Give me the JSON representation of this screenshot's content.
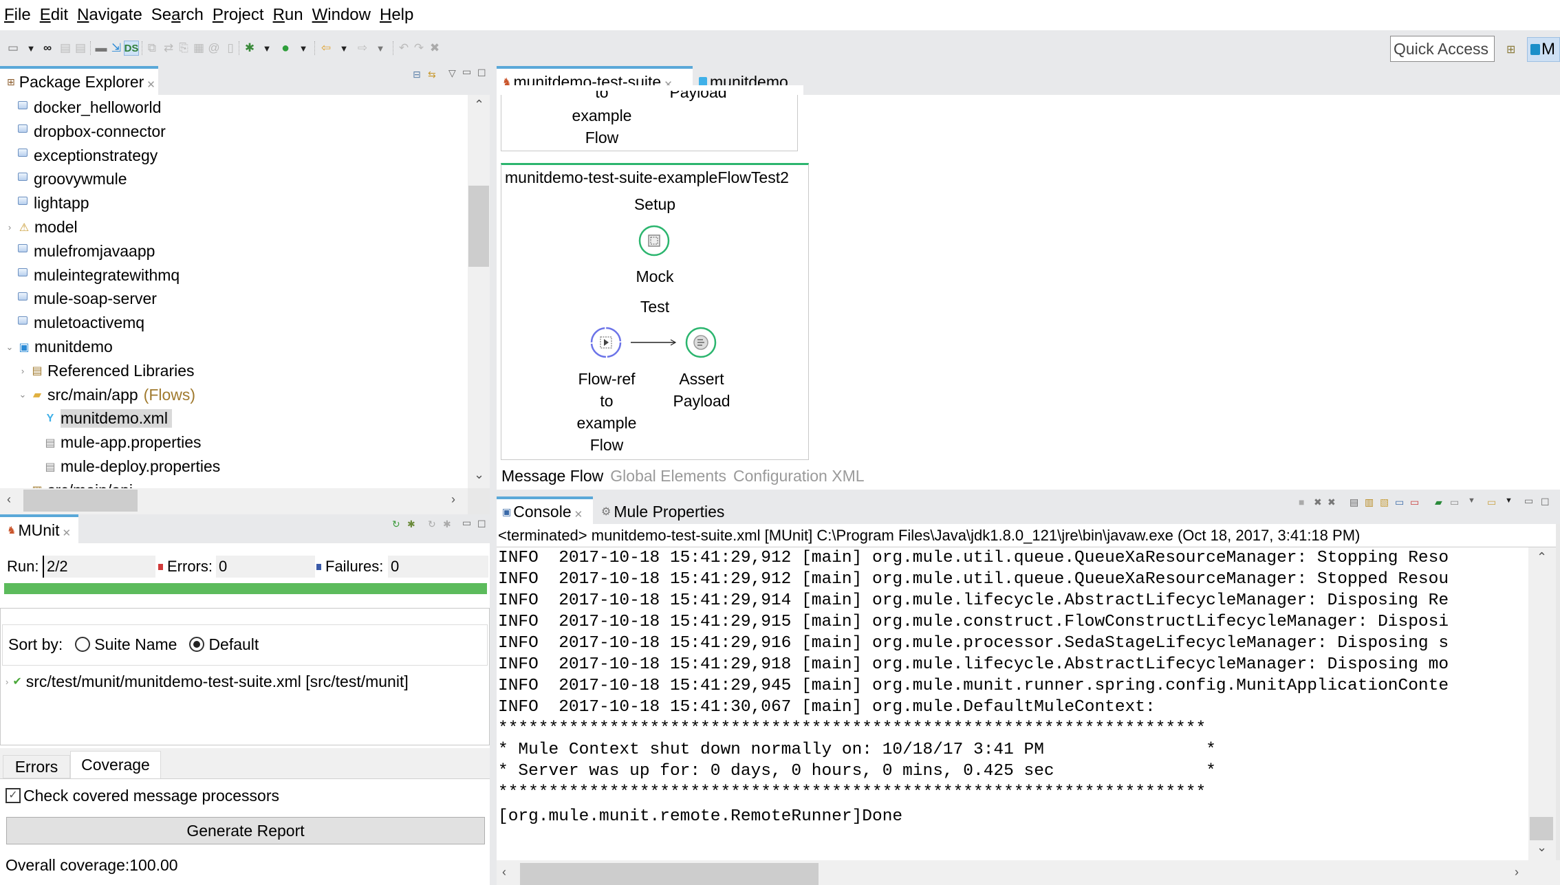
{
  "menu": [
    "File",
    "Edit",
    "Navigate",
    "Search",
    "Project",
    "Run",
    "Window",
    "Help"
  ],
  "menu_mnemonics": [
    "F",
    "E",
    "N",
    "a",
    "P",
    "R",
    "W",
    "H"
  ],
  "toolbar": {
    "quick_access": "Quick Access",
    "perspective_label": "M",
    "icons": [
      "new-icon",
      "dropdown-icon",
      "mule-icon",
      "save-icon",
      "save-all-icon",
      "deploy-icon",
      "import-icon",
      "datasense-icon",
      "compare-icon",
      "sync-icon",
      "export-icon",
      "report-icon",
      "email-icon",
      "archive-icon",
      "debug-icon",
      "dropdown-icon",
      "run-icon",
      "dropdown-icon",
      "back-icon",
      "dropdown-icon",
      "forward-icon",
      "dropdown-icon",
      "undo-icon",
      "redo-icon",
      "delete-icon"
    ]
  },
  "package_explorer": {
    "title": "Package Explorer",
    "items": [
      {
        "label": "docker_helloworld",
        "level": 0,
        "icon": "project",
        "twisty": ""
      },
      {
        "label": "dropbox-connector",
        "level": 0,
        "icon": "project",
        "twisty": ""
      },
      {
        "label": "exceptionstrategy",
        "level": 0,
        "icon": "project",
        "twisty": ""
      },
      {
        "label": "groovywmule",
        "level": 0,
        "icon": "project",
        "twisty": ""
      },
      {
        "label": "lightapp",
        "level": 0,
        "icon": "project",
        "twisty": ""
      },
      {
        "label": "model",
        "level": 0,
        "icon": "java-project-warning",
        "twisty": "collapsed"
      },
      {
        "label": "mulefromjavaapp",
        "level": 0,
        "icon": "project",
        "twisty": ""
      },
      {
        "label": "muleintegratewithmq",
        "level": 0,
        "icon": "project",
        "twisty": ""
      },
      {
        "label": "mule-soap-server",
        "level": 0,
        "icon": "project",
        "twisty": ""
      },
      {
        "label": "muletoactivemq",
        "level": 0,
        "icon": "project",
        "twisty": ""
      },
      {
        "label": "munitdemo",
        "level": 0,
        "icon": "mule-project",
        "twisty": "expanded"
      },
      {
        "label": "Referenced Libraries",
        "level": 1,
        "icon": "libraries",
        "twisty": "collapsed"
      },
      {
        "label": "src/main/app",
        "level": 1,
        "icon": "source-folder",
        "twisty": "expanded",
        "decoration": "(Flows)"
      },
      {
        "label": "munitdemo.xml",
        "level": 2,
        "icon": "mule-file",
        "twisty": "",
        "selected": true
      },
      {
        "label": "mule-app.properties",
        "level": 2,
        "icon": "file",
        "twisty": ""
      },
      {
        "label": "mule-deploy.properties",
        "level": 2,
        "icon": "file",
        "twisty": ""
      },
      {
        "label": "src/main/api",
        "level": 1,
        "icon": "package-folder",
        "twisty": ""
      }
    ]
  },
  "munit": {
    "title": "MUnit",
    "run_label": "Run:",
    "run_value": "2/2",
    "errors_label": "Errors:",
    "errors_value": "0",
    "failures_label": "Failures:",
    "failures_value": "0",
    "progress": 1.0,
    "progress_color": "#5cbb5c",
    "sort_label": "Sort by:",
    "sort_options": [
      {
        "label": "Suite Name",
        "selected": false
      },
      {
        "label": "Default",
        "selected": true
      }
    ],
    "result_item": "src/test/munit/munitdemo-test-suite.xml [src/test/munit]",
    "tabs": [
      {
        "label": "Errors",
        "active": false
      },
      {
        "label": "Coverage",
        "active": true
      }
    ],
    "check_label": "Check covered message processors",
    "check_checked": true,
    "generate_button": "Generate Report",
    "coverage_text": "Overall coverage:100.00"
  },
  "editor": {
    "tabs": [
      {
        "label": "munitdemo-test-suite",
        "active": true
      },
      {
        "label": "munitdemo",
        "active": false
      }
    ],
    "prev_flow_lines": {
      "left": [
        "to",
        "example",
        "Flow"
      ],
      "right": "Payload"
    },
    "flow_title": "munitdemo-test-suite-exampleFlowTest2",
    "setup_label": "Setup",
    "mock_label": "Mock",
    "test_label": "Test",
    "flowref_label": [
      "Flow-ref",
      "to",
      "example",
      "Flow"
    ],
    "assert_label": [
      "Assert",
      "Payload"
    ],
    "bottom_tabs": [
      {
        "label": "Message Flow",
        "active": true
      },
      {
        "label": "Global Elements",
        "active": false
      },
      {
        "label": "Configuration XML",
        "active": false
      }
    ],
    "colors": {
      "mock": "#2bb56e",
      "flowref": "#6b73e8",
      "assert": "#2bb56e"
    }
  },
  "console": {
    "tabs": [
      {
        "label": "Console",
        "active": true
      },
      {
        "label": "Mule Properties",
        "active": false
      }
    ],
    "header": "<terminated> munitdemo-test-suite.xml [MUnit] C:\\Program Files\\Java\\jdk1.8.0_121\\jre\\bin\\javaw.exe (Oct 18, 2017, 3:41:18 PM)",
    "lines": [
      "INFO  2017-10-18 15:41:29,912 [main] org.mule.util.queue.QueueXaResourceManager: Stopping Reso",
      "INFO  2017-10-18 15:41:29,912 [main] org.mule.util.queue.QueueXaResourceManager: Stopped Resou",
      "INFO  2017-10-18 15:41:29,914 [main] org.mule.lifecycle.AbstractLifecycleManager: Disposing Re",
      "INFO  2017-10-18 15:41:29,915 [main] org.mule.construct.FlowConstructLifecycleManager: Disposi",
      "INFO  2017-10-18 15:41:29,916 [main] org.mule.processor.SedaStageLifecycleManager: Disposing s",
      "INFO  2017-10-18 15:41:29,918 [main] org.mule.lifecycle.AbstractLifecycleManager: Disposing mo",
      "INFO  2017-10-18 15:41:29,945 [main] org.mule.munit.runner.spring.config.MunitApplicationConte",
      "INFO  2017-10-18 15:41:30,067 [main] org.mule.DefaultMuleContext:",
      "**********************************************************************",
      "* Mule Context shut down normally on: 10/18/17 3:41 PM                *",
      "* Server was up for: 0 days, 0 hours, 0 mins, 0.425 sec               *",
      "**********************************************************************",
      "[org.mule.munit.remote.RemoteRunner]Done"
    ]
  }
}
